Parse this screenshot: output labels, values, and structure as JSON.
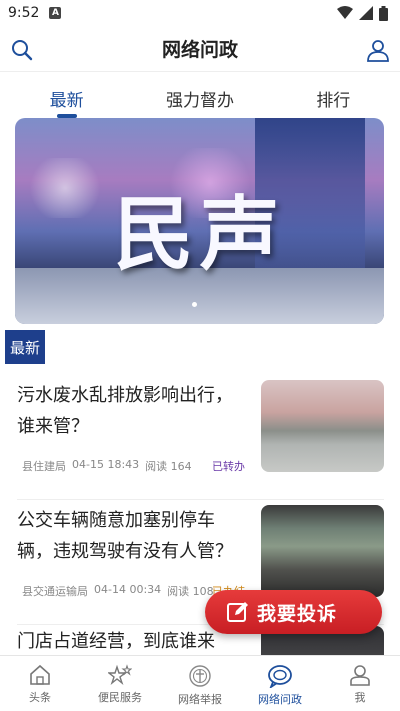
{
  "status_bar": {
    "time": "9:52",
    "notif_badge": "A"
  },
  "header": {
    "title": "网络问政"
  },
  "tabs": [
    {
      "label": "最新",
      "active": true
    },
    {
      "label": "强力督办",
      "active": false
    },
    {
      "label": "排行",
      "active": false
    }
  ],
  "banner": {
    "text": "民声",
    "slide_count": 1,
    "current_slide": 1
  },
  "section": {
    "label": "最新"
  },
  "news": [
    {
      "title": "污水废水乱排放影响出行，谁来管？",
      "dept": "县住建局",
      "date": "04-15 18:43",
      "views": "阅读 164",
      "status": "已转办",
      "status_color": "#6a3aa8"
    },
    {
      "title": "公交车辆随意加塞别停车辆，违规驾驶有没有人管？",
      "dept": "县交通运输局",
      "date": "04-14 00:34",
      "views": "阅读 108",
      "status": "已办结",
      "status_color": "#d28a1a"
    },
    {
      "title": "门店占道经营，到底谁来",
      "dept": "",
      "date": "",
      "views": "",
      "status": "",
      "status_color": "#888888"
    }
  ],
  "fab": {
    "label": "我要投诉"
  },
  "bottom_nav": [
    {
      "label": "头条",
      "icon": "home-icon",
      "active": false
    },
    {
      "label": "便民服务",
      "icon": "stars-icon",
      "active": false
    },
    {
      "label": "网络举报",
      "icon": "report-seal-icon",
      "active": false
    },
    {
      "label": "网络问政",
      "icon": "chat-bubble-icon",
      "active": true
    },
    {
      "label": "我",
      "icon": "person-icon",
      "active": false
    }
  ],
  "colors": {
    "primary": "#1e4f9c",
    "fab_red": "#d62a2f",
    "section_bg": "#1e3f8c"
  }
}
